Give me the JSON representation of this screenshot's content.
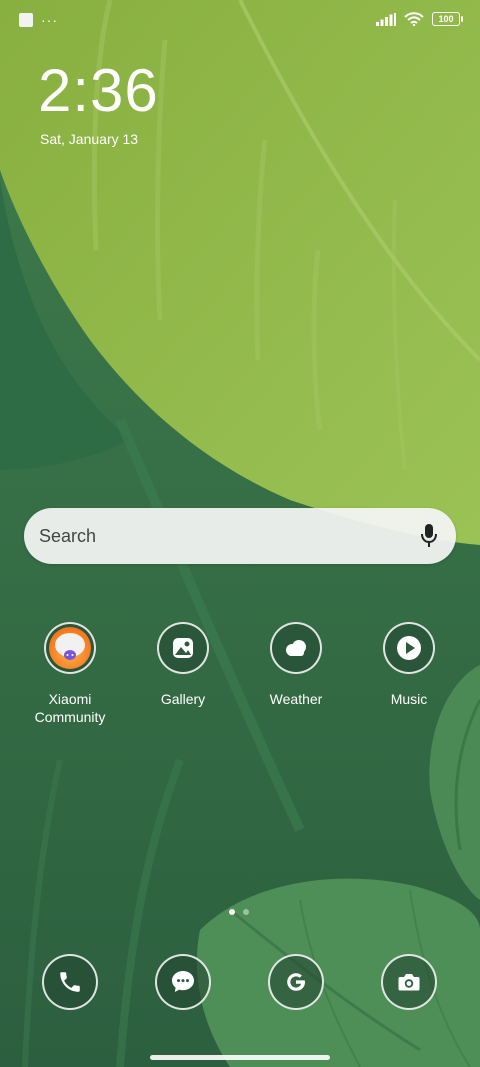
{
  "status_bar": {
    "notification_dots": "···",
    "battery": "100"
  },
  "clock": {
    "time": "2:36",
    "date": "Sat, January 13"
  },
  "search": {
    "label": "Search"
  },
  "apps": [
    {
      "label": "Xiaomi\nCommunity",
      "icon": "xiaomi-community-icon"
    },
    {
      "label": "Gallery",
      "icon": "gallery-icon"
    },
    {
      "label": "Weather",
      "icon": "weather-icon"
    },
    {
      "label": "Music",
      "icon": "music-icon"
    }
  ],
  "dock": [
    {
      "icon": "phone-icon"
    },
    {
      "icon": "messages-icon"
    },
    {
      "icon": "google-icon"
    },
    {
      "icon": "camera-icon"
    }
  ],
  "page_indicator": {
    "total": 2,
    "current": 1
  },
  "colors": {
    "wallpaper_dark": "#2f6a45",
    "leaf_light": "#8fb748"
  }
}
